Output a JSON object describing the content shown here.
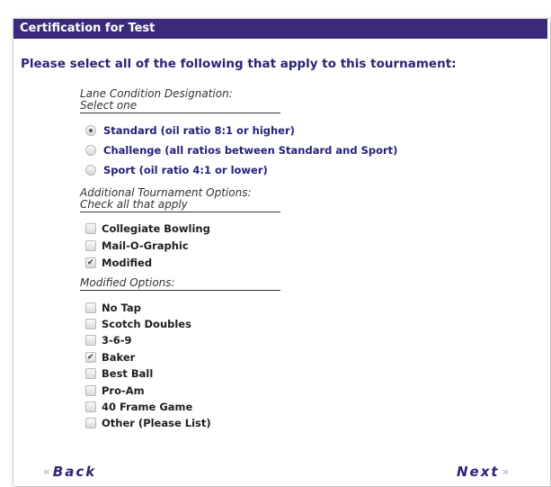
{
  "title": "Certification for Test",
  "prompt": "Please select all of the following that apply to this tournament:",
  "lane": {
    "heading_line1": "Lane Condition Designation:",
    "heading_line2": "Select one",
    "options": [
      {
        "label": "Standard (oil ratio 8:1 or higher)",
        "selected": true
      },
      {
        "label": "Challenge (all ratios between Standard and Sport)",
        "selected": false
      },
      {
        "label": "Sport (oil ratio 4:1 or lower)",
        "selected": false
      }
    ]
  },
  "additional": {
    "heading_line1": "Additional Tournament Options:",
    "heading_line2": "Check all that apply",
    "options": [
      {
        "label": "Collegiate Bowling",
        "checked": false
      },
      {
        "label": "Mail-O-Graphic",
        "checked": false
      },
      {
        "label": "Modified",
        "checked": true
      }
    ]
  },
  "modified": {
    "heading": "Modified Options:",
    "options": [
      {
        "label": "No Tap",
        "checked": false
      },
      {
        "label": "Scotch Doubles",
        "checked": false
      },
      {
        "label": "3-6-9",
        "checked": false
      },
      {
        "label": "Baker",
        "checked": true
      },
      {
        "label": "Best Ball",
        "checked": false
      },
      {
        "label": "Pro-Am",
        "checked": false
      },
      {
        "label": "40 Frame Game",
        "checked": false
      },
      {
        "label": "Other (Please List)",
        "checked": false
      }
    ]
  },
  "nav": {
    "back_label": "Back",
    "next_label": "Next",
    "back_arrow": "«",
    "next_arrow": "»"
  },
  "colors": {
    "title_bar": "#3b2a7a",
    "prompt_text": "#2a2575",
    "option_text_blue": "#24207a"
  }
}
